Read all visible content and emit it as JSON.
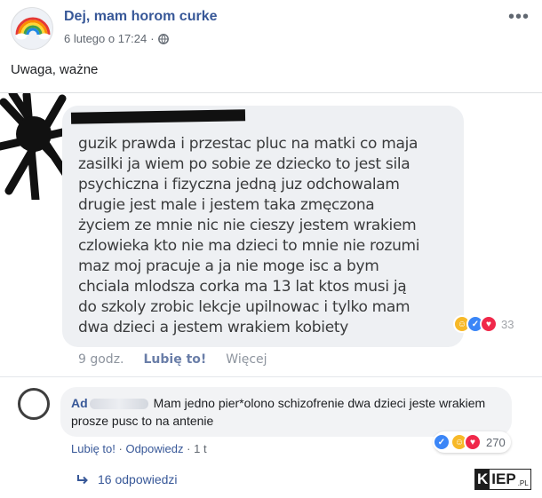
{
  "post": {
    "page_name": "Dej, mam horom curke",
    "date": "6 lutego o 17:24",
    "separator": "·",
    "text": "Uwaga, ważne"
  },
  "quoted_comment": {
    "text": "guzik prawda i przestac pluc na matki co maja\nzasilki ja wiem po sobie ze dziecko to jest sila\npsychiczna i fizyczna jedną juz odchowalam\ndrugie jest male i jestem taka zmęczona\nżyciem ze mnie nic nie cieszy jestem wrakiem\nczlowieka kto nie ma dzieci to mnie nie rozumi\nmaz moj pracuje a ja nie moge isc a bym\nchciala mlodsza corka ma 13 lat ktos musi ją\ndo szkoly zrobic lekcje upilnowac i tylko mam\ndwa dzieci a jestem wrakiem kobiety",
    "reaction_count": "33",
    "time": "9 godz.",
    "like_label": "Lubię to!",
    "more_label": "Więcej"
  },
  "comment": {
    "author": "Ad",
    "text": "Mam jedno pier*olono schizofrenie dwa dzieci jeste wrakiem prosze pusc to na antenie",
    "like_label": "Lubię to!",
    "reply_label": "Odpowiedz",
    "time": "1 t",
    "separator": "·",
    "reaction_count": "270"
  },
  "replies": {
    "label": "16 odpowiedzi"
  },
  "watermark": {
    "k": "K",
    "rest": "IEP",
    "pl": ".PL"
  },
  "colors": {
    "link_blue": "#385898",
    "bubble_grey": "#f2f3f5",
    "like_blue": "#3b86f7",
    "haha_yellow": "#f7b928",
    "love_red": "#f0284a"
  },
  "icons": {
    "avatar": "rainbow-icon",
    "audience": "globe-icon",
    "menu": "more-icon",
    "replies": "reply-arrow-icon"
  }
}
